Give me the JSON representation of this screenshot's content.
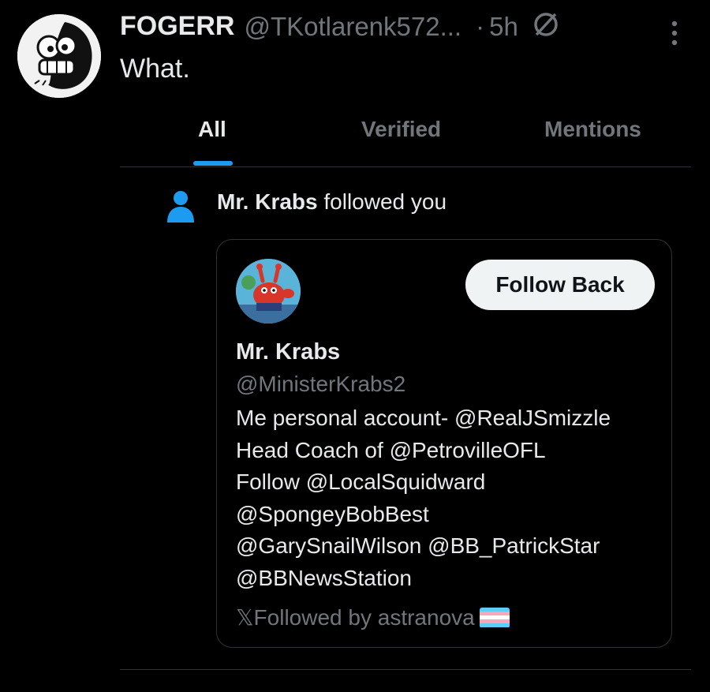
{
  "post": {
    "author_name": "FOGERR",
    "author_handle": "@TKotlarenk572...",
    "separator": "·",
    "time": "5h",
    "text": "What.",
    "avatar_icon": "cartoon-face-avatar",
    "status_icon": "no-symbol-icon",
    "more_icon": "vertical-dots-icon"
  },
  "tabs": [
    {
      "label": "All",
      "active": true
    },
    {
      "label": "Verified",
      "active": false
    },
    {
      "label": "Mentions",
      "active": false
    }
  ],
  "notification": {
    "icon": "person-icon",
    "actor": "Mr. Krabs",
    "action": "followed you"
  },
  "card": {
    "name": "Mr. Krabs",
    "handle": "@MinisterKrabs2",
    "follow_button": "Follow Back",
    "bio_lines": [
      "Me personal account-  @RealJSmizzle",
      "Head Coach of @PetrovilleOFL",
      "Follow @LocalSquidward",
      "@SpongeyBobBest",
      "@GarySnailWilson @BB_PatrickStar",
      "@BBNewsStation"
    ],
    "followed_by": "𝕏Followed by astranova",
    "flag_icon": "trans-flag-icon"
  },
  "colors": {
    "background": "#000000",
    "text": "#e7e9ea",
    "muted": "#71767b",
    "accent": "#1d9bf0",
    "divider": "#2f3336",
    "button_bg": "#eff3f4"
  }
}
